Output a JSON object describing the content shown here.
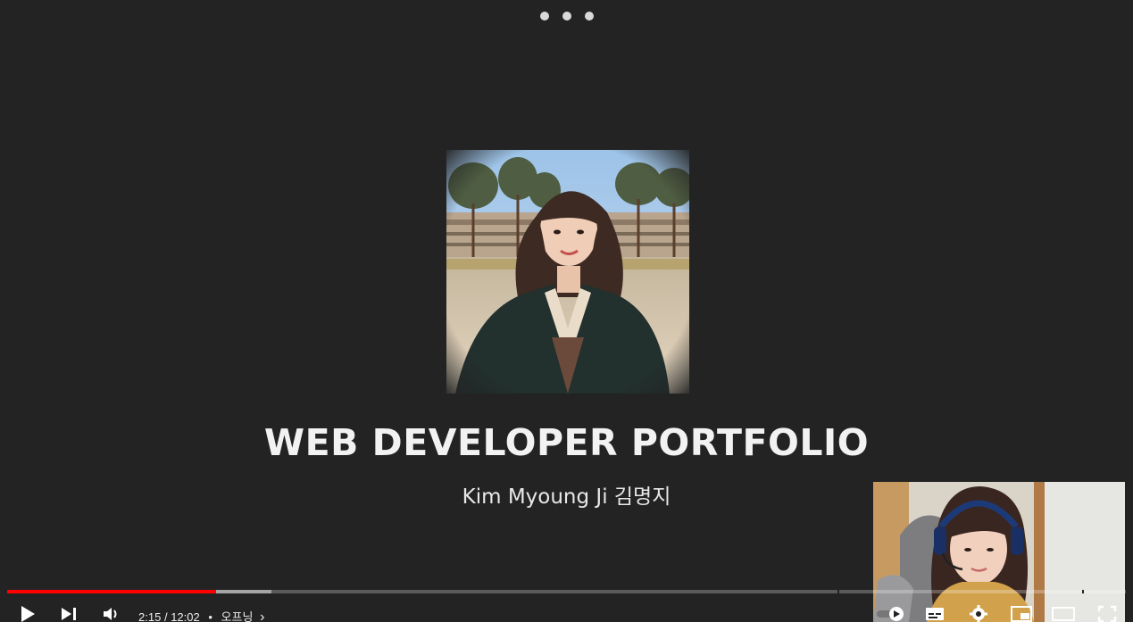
{
  "video": {
    "slide_title": "WEB DEVELOPER PORTFOLIO",
    "slide_subtitle": "Kim Myoung Ji 김명지"
  },
  "player": {
    "current_time": "2:15",
    "time_separator": "/",
    "duration": "12:02",
    "chapter_bullet": "•",
    "chapter_title": "오프닝",
    "chapter_chevron": "›",
    "progress_played_fraction": 0.187,
    "progress_buffered_fraction": 0.236
  },
  "icons": {
    "play": "play-icon",
    "next": "next-icon",
    "volume": "volume-icon",
    "autoplay": "autoplay-toggle-icon",
    "subtitles": "subtitles-icon",
    "settings": "gear-icon",
    "miniplayer": "miniplayer-icon",
    "theater": "theater-icon",
    "fullscreen": "fullscreen-icon"
  },
  "colors": {
    "progress_played": "#ff0000",
    "background": "#232323"
  }
}
